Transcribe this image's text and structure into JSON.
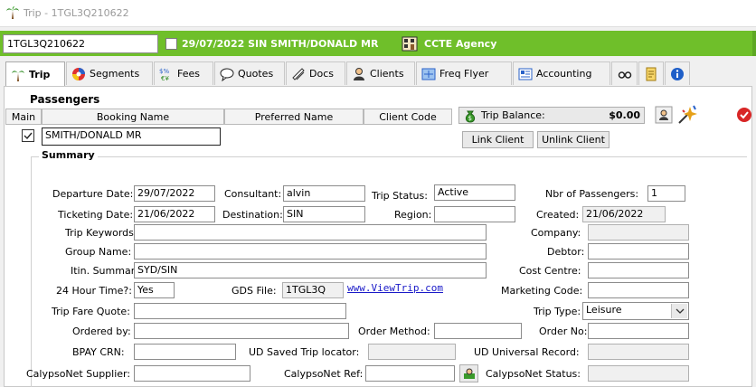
{
  "window": {
    "title": "Trip - 1TGL3Q210622"
  },
  "toolbar": {
    "trip_id": "1TGL3Q210622",
    "trip_summary": "29/07/2022 SIN SMITH/DONALD MR",
    "agency": "CCTE Agency"
  },
  "tabs": [
    {
      "label": "Trip",
      "icon": "palm-tree-icon"
    },
    {
      "label": "Segments",
      "icon": "segments-icon"
    },
    {
      "label": "Fees",
      "icon": "fees-icon"
    },
    {
      "label": "Quotes",
      "icon": "speech-bubble-icon"
    },
    {
      "label": "Docs",
      "icon": "docs-icon"
    },
    {
      "label": "Clients",
      "icon": "clients-icon"
    },
    {
      "label": "Freq Flyer",
      "icon": "freq-flyer-icon"
    },
    {
      "label": "Accounting",
      "icon": "accounting-icon"
    }
  ],
  "passengers": {
    "heading": "Passengers",
    "columns": [
      "Main",
      "Booking Name",
      "Preferred Name",
      "Client Code"
    ],
    "rows": [
      {
        "main": true,
        "booking_name": "SMITH/DONALD MR",
        "preferred_name": "",
        "client_code": ""
      }
    ],
    "trip_balance_label": "Trip Balance:",
    "trip_balance_value": "$0.00",
    "link_client": "Link Client",
    "unlink_client": "Unlink Client"
  },
  "summary": {
    "heading": "Summary",
    "departure_date_label": "Departure Date:",
    "departure_date": "29/07/2022",
    "consultant_label": "Consultant:",
    "consultant": "alvin",
    "trip_status_label": "Trip Status:",
    "trip_status": "Active",
    "nbr_passengers_label": "Nbr of Passengers:",
    "nbr_passengers": "1",
    "ticketing_date_label": "Ticketing Date:",
    "ticketing_date": "21/06/2022",
    "destination_label": "Destination:",
    "destination": "SIN",
    "region_label": "Region:",
    "region": "",
    "created_label": "Created:",
    "created": "21/06/2022",
    "trip_keywords_label": "Trip Keywords:",
    "trip_keywords": "",
    "company_label": "Company:",
    "company": "",
    "group_name_label": "Group Name:",
    "group_name": "",
    "debtor_label": "Debtor:",
    "debtor": "",
    "itin_summary_label": "Itin. Summary:",
    "itin_summary": "SYD/SIN",
    "cost_centre_label": "Cost Centre:",
    "cost_centre": "",
    "hour24_label": "24 Hour Time?:",
    "hour24": "Yes",
    "gds_file_label": "GDS File:",
    "gds_file": "1TGL3Q",
    "viewtrip_link": "www.ViewTrip.com",
    "marketing_code_label": "Marketing Code:",
    "marketing_code": "",
    "trip_fare_quote_label": "Trip Fare Quote:",
    "trip_fare_quote": "",
    "trip_type_label": "Trip Type:",
    "trip_type": "Leisure",
    "ordered_by_label": "Ordered by:",
    "ordered_by": "",
    "order_method_label": "Order Method:",
    "order_method": "",
    "order_no_label": "Order No:",
    "order_no": "",
    "bpay_crn_label": "BPAY CRN:",
    "bpay_crn": "",
    "ud_saved_label": "UD Saved Trip locator:",
    "ud_saved": "",
    "ud_universal_label": "UD Universal Record:",
    "ud_universal": "",
    "calypso_supplier_label": "CalypsoNet Supplier:",
    "calypso_supplier": "",
    "calypso_ref_label": "CalypsoNet Ref:",
    "calypso_ref": "",
    "calypso_status_label": "CalypsoNet Status:",
    "calypso_status": ""
  }
}
